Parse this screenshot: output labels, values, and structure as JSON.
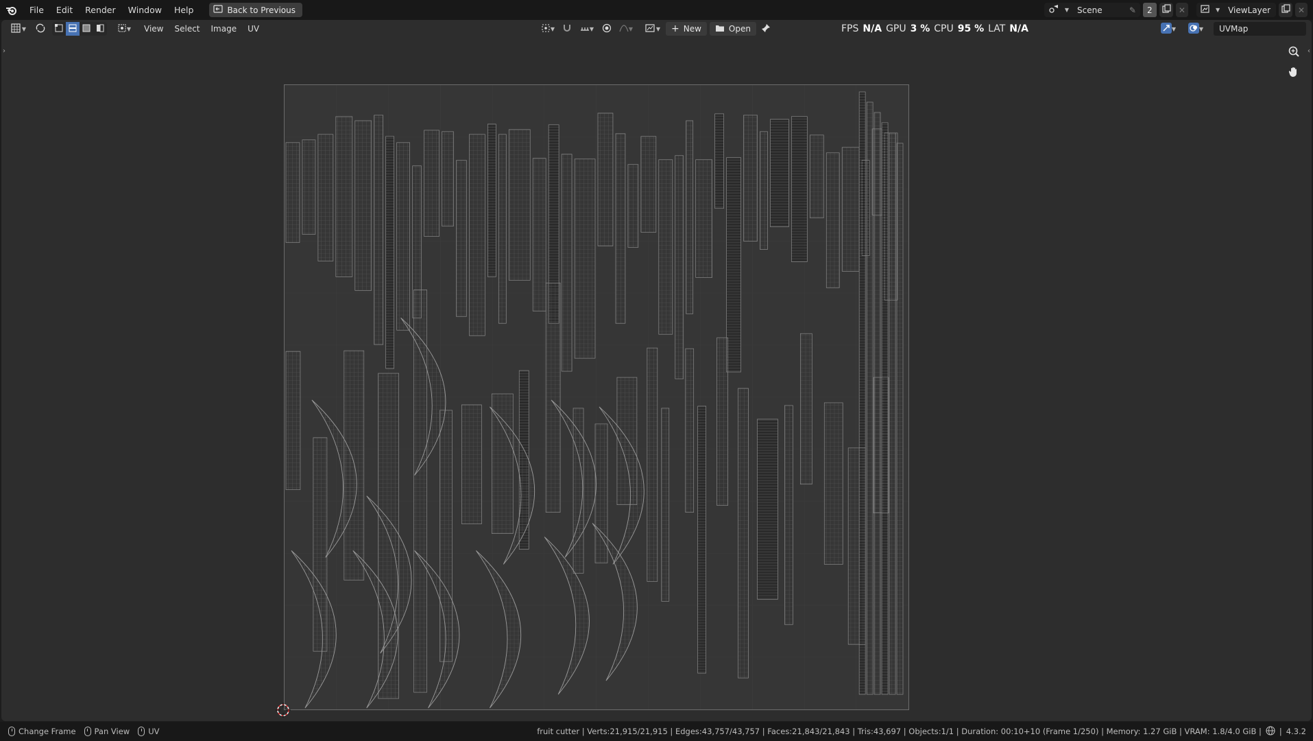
{
  "menu": {
    "items": [
      "File",
      "Edit",
      "Render",
      "Window",
      "Help"
    ],
    "back_button": "Back to Previous"
  },
  "top_right": {
    "scene_label": "Scene",
    "scene_count": "2",
    "view_layer_label": "ViewLayer"
  },
  "header": {
    "menus": [
      "View",
      "Select",
      "Image",
      "UV"
    ],
    "new_label": "New",
    "open_label": "Open",
    "uvmap": "UVMap"
  },
  "stats": {
    "fps_label": "FPS",
    "fps_value": "N/A",
    "gpu_label": "GPU",
    "gpu_value": "3 %",
    "cpu_label": "CPU",
    "cpu_value": "95 %",
    "lat_label": "LAT",
    "lat_value": "N/A"
  },
  "statusbar": {
    "hints": [
      "Change Frame",
      "Pan View",
      "UV"
    ],
    "info": "fruit cutter | Verts:21,915/21,915 | Edges:43,757/43,757 | Faces:21,843/21,843 | Tris:43,697 | Objects:1/1 | Duration: 00:10+10 (Frame 1/250) | Memory: 1.27 GiB | VRAM: 1.8/4.0 GiB |",
    "version": "4.3.2"
  },
  "icons": {
    "app": "blender-logo-icon",
    "zoom": "zoom-icon",
    "pan": "hand-pan-icon",
    "cursor": "2d-cursor-icon"
  }
}
